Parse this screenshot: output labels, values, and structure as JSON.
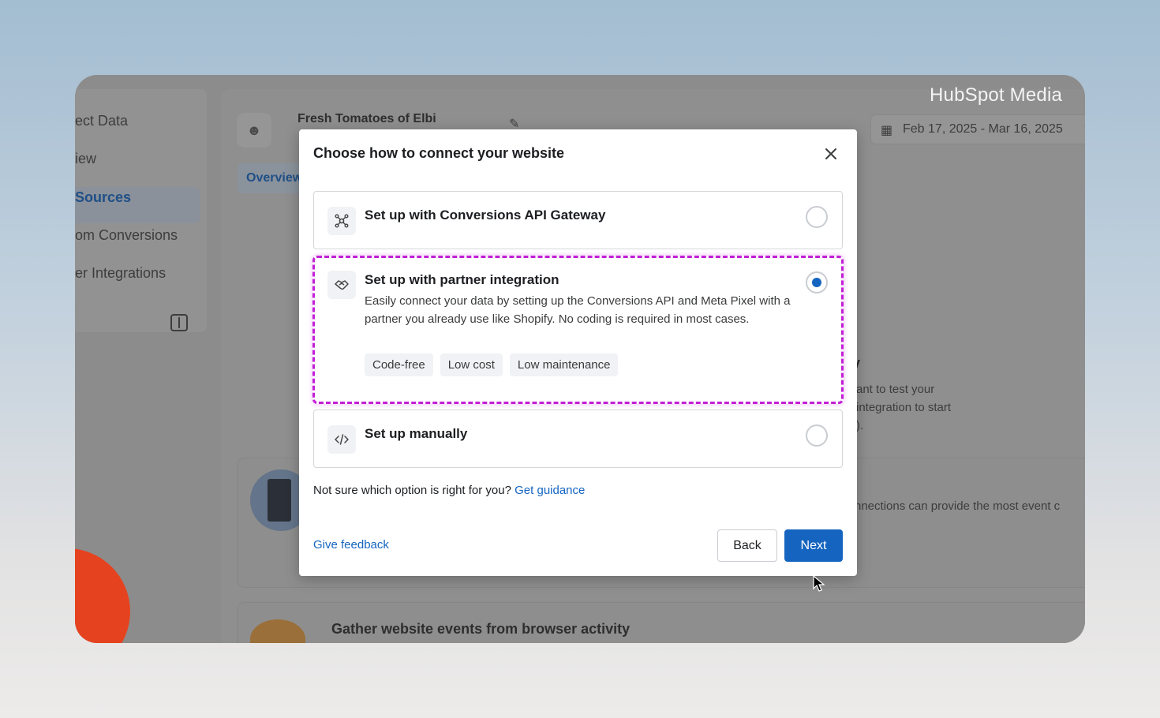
{
  "watermark": "HubSpot Media",
  "sidebar": {
    "items": [
      {
        "label": "ect Data"
      },
      {
        "label": "iew"
      },
      {
        "label": "Sources"
      },
      {
        "label": "om Conversions"
      },
      {
        "label": "er Integrations"
      }
    ]
  },
  "header": {
    "account_name": "Fresh Tomatoes of Elbi",
    "tab_overview": "Overview",
    "date_range": "Feb 17, 2025 - Mar 16, 2025"
  },
  "background": {
    "partial_heading": "y",
    "partial_line1": "ant to test your",
    "partial_line2": "integration to start",
    "partial_line3": ").",
    "partial_line4": "nnections can provide the most event c",
    "section_heading": "Gather website events from browser activity"
  },
  "modal": {
    "title": "Choose how to connect your website",
    "options": [
      {
        "title": "Set up with Conversions API Gateway",
        "selected": false,
        "icon": "gateway-icon"
      },
      {
        "title": "Set up with partner integration",
        "description": "Easily connect your data by setting up the Conversions API and Meta Pixel with a partner you already use like Shopify. No coding is required in most cases.",
        "tags": [
          "Code-free",
          "Low cost",
          "Low maintenance"
        ],
        "selected": true,
        "icon": "handshake-icon"
      },
      {
        "title": "Set up manually",
        "selected": false,
        "icon": "code-icon"
      }
    ],
    "guidance_text": "Not sure which option is right for you?",
    "guidance_link": "Get guidance",
    "feedback_link": "Give feedback",
    "back_label": "Back",
    "next_label": "Next"
  },
  "colors": {
    "accent": "#1565c0",
    "highlight": "#c21fd6",
    "overlay": "#8c8c8c"
  }
}
